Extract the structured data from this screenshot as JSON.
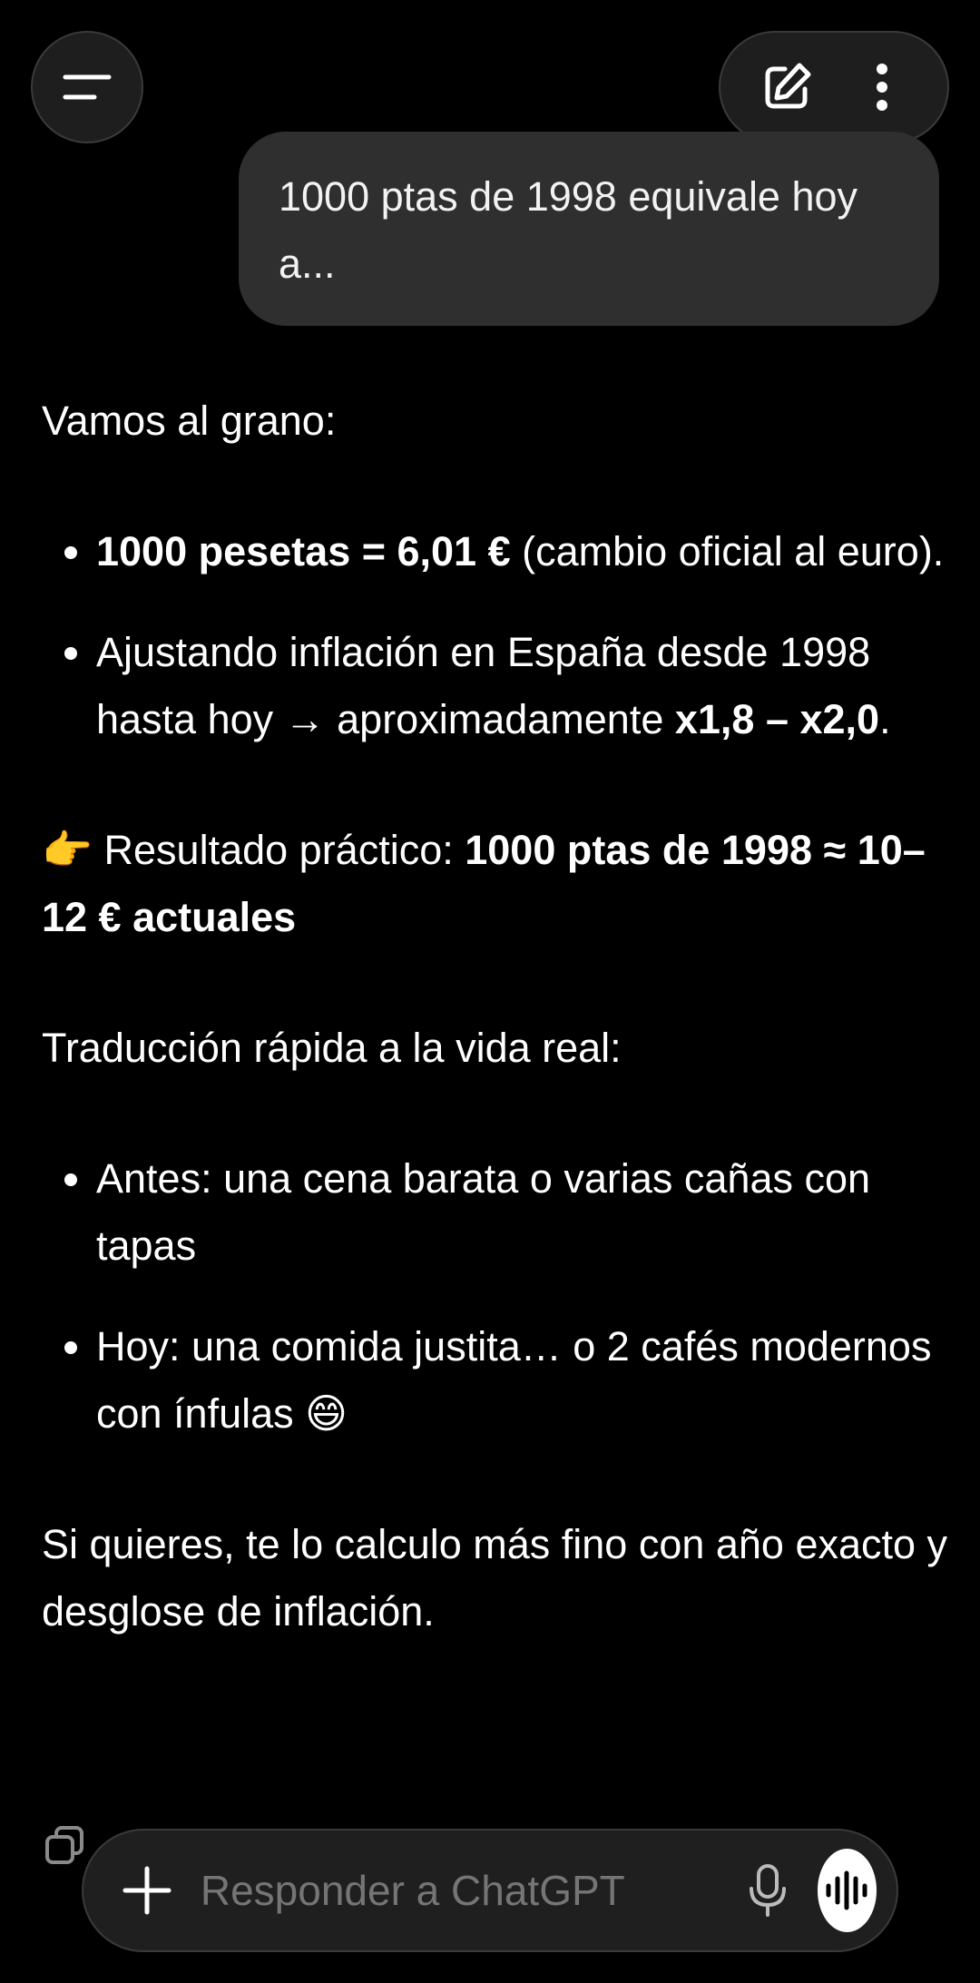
{
  "header": {
    "menu_icon": "menu-icon",
    "new_chat_icon": "edit-icon",
    "more_icon": "more-vertical-icon"
  },
  "user_message": {
    "text": "1000 ptas de 1998 equivale hoy a..."
  },
  "response": {
    "intro": "Vamos al grano:",
    "bullets_1": [
      {
        "bold": "1000 pesetas = 6,01 €",
        "text": " (cambio oficial al euro)."
      },
      {
        "text": "Ajustando inflación en España desde 1998 hasta hoy → aproximadamente ",
        "bold": "x1,8 – x2,0",
        "tail": "."
      }
    ],
    "result_emoji": "👉",
    "result_text": " Resultado práctico: ",
    "result_bold": "1000 ptas de 1998 ≈ 10–12 € actuales",
    "translation_intro": "Traducción rápida a la vida real:",
    "bullets_2": [
      {
        "text": "Antes: una cena barata o varias cañas con tapas"
      },
      {
        "text": "Hoy: una comida justita… o 2 cafés modernos con ínfulas ",
        "emoji": "😄"
      }
    ],
    "closing": "Si quieres, te lo calculo más fino con año exacto y desglose de inflación."
  },
  "composer": {
    "placeholder": "Responder a ChatGPT",
    "plus_icon": "plus-icon",
    "mic_icon": "mic-icon",
    "voice_icon": "voice-waveform-icon"
  },
  "bottom_tools": {
    "copy_icon": "copy-icon"
  }
}
